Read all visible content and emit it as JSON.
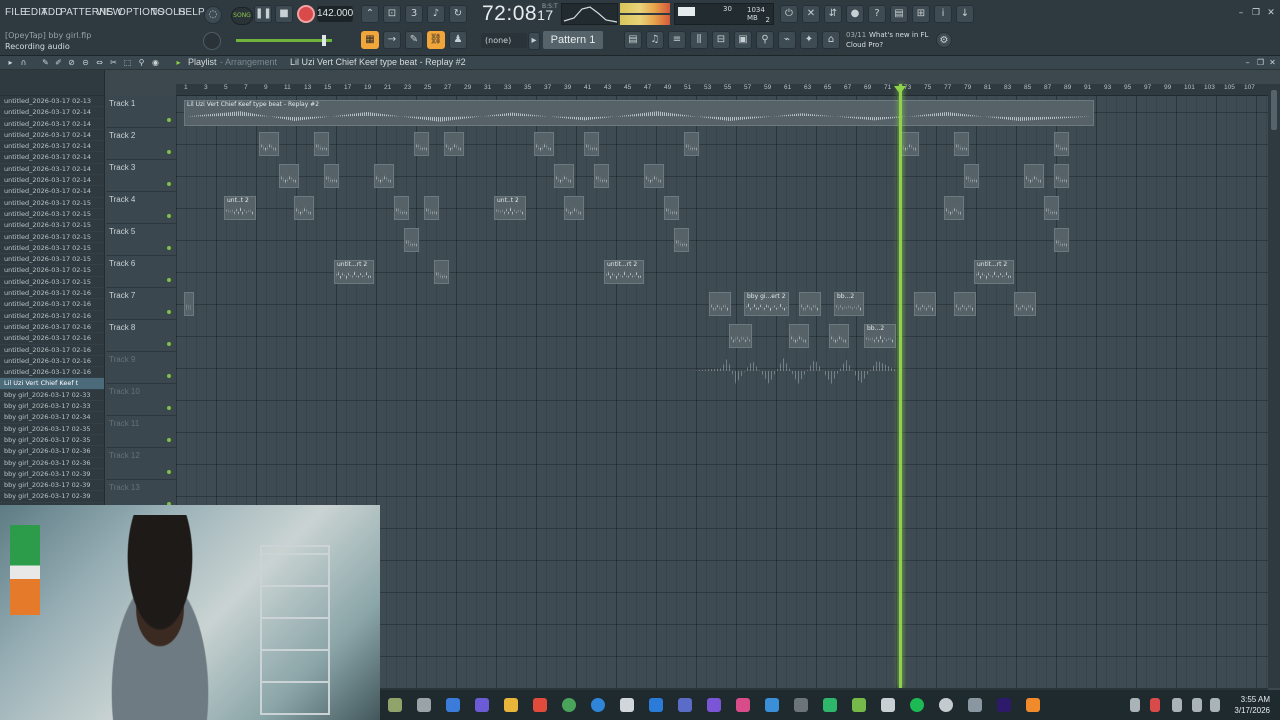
{
  "menu": [
    "FILE",
    "EDIT",
    "ADD",
    "PATTERNS",
    "VIEW",
    "OPTIONS",
    "TOOLS",
    "HELP"
  ],
  "project": {
    "label": "[OpeyTap] bby girl.flp",
    "status": "Recording audio"
  },
  "transport": {
    "mode": "SONG",
    "tempo": "142.000",
    "time": "72:08",
    "time_ticks": "17",
    "time_sub": "B:S:T"
  },
  "monitor": {
    "memory": "1034 MB",
    "voices": "30",
    "poly": "2"
  },
  "toolbar": {
    "pattern_none": "(none)",
    "pattern": "Pattern 1"
  },
  "news": {
    "date": "03/11",
    "text": "What's new in FL",
    "text2": "Cloud Pro?"
  },
  "playlist": {
    "title": "Playlist",
    "arrow": "-",
    "arrangement": "Arrangement",
    "breadcrumb": "Lil Uzi Vert  Chief Keef type beat - Replay #2"
  },
  "browser_items": [
    "untitled_2026-03-17 02-13",
    "untitled_2026-03-17 02-14",
    "untitled_2026-03-17 02-14",
    "untitled_2026-03-17 02-14",
    "untitled_2026-03-17 02-14",
    "untitled_2026-03-17 02-14",
    "untitled_2026-03-17 02-14",
    "untitled_2026-03-17 02-14",
    "untitled_2026-03-17 02-14",
    "untitled_2026-03-17 02-15",
    "untitled_2026-03-17 02-15",
    "untitled_2026-03-17 02-15",
    "untitled_2026-03-17 02-15",
    "untitled_2026-03-17 02-15",
    "untitled_2026-03-17 02-15",
    "untitled_2026-03-17 02-15",
    "untitled_2026-03-17 02-15",
    "untitled_2026-03-17 02-16",
    "untitled_2026-03-17 02-16",
    "untitled_2026-03-17 02-16",
    "untitled_2026-03-17 02-16",
    "untitled_2026-03-17 02-16",
    "untitled_2026-03-17 02-16",
    "untitled_2026-03-17 02-16",
    "untitled_2026-03-17 02-16",
    "Lil Uzi Vert  Chief Keef t",
    "bby girl_2026-03-17 02-33",
    "bby girl_2026-03-17 02-33",
    "bby girl_2026-03-17 02-34",
    "bby girl_2026-03-17 02-35",
    "bby girl_2026-03-17 02-35",
    "bby girl_2026-03-17 02-36",
    "bby girl_2026-03-17 02-36",
    "bby girl_2026-03-17 02-39",
    "bby girl_2026-03-17 02-39",
    "bby girl_2026-03-17 02-39"
  ],
  "selected_browser_index": 25,
  "tracks": [
    "Track 1",
    "Track 2",
    "Track 3",
    "Track 4",
    "Track 5",
    "Track 6",
    "Track 7",
    "Track 8",
    "Track 9",
    "Track 10",
    "Track 11",
    "Track 12",
    "Track 13"
  ],
  "ruler_ticks": [
    "1",
    "3",
    "5",
    "7",
    "9",
    "11",
    "13",
    "15",
    "17",
    "19",
    "21",
    "23",
    "25",
    "27",
    "29",
    "31",
    "33",
    "35",
    "37",
    "39",
    "41",
    "43",
    "45",
    "47",
    "49",
    "51",
    "53",
    "55",
    "57",
    "59",
    "61",
    "63",
    "65",
    "67",
    "69",
    "71",
    "73",
    "75",
    "77",
    "79",
    "81",
    "83",
    "85",
    "87",
    "89",
    "91",
    "93",
    "95",
    "97",
    "99",
    "101",
    "103",
    "105",
    "107"
  ],
  "clips": [
    {
      "track": 0,
      "start": 1,
      "len": 91,
      "label": "Lil Uzi Vert  Chief Keef type beat - Replay #2"
    },
    {
      "track": 1,
      "start": 8.5,
      "len": 2,
      "label": ""
    },
    {
      "track": 1,
      "start": 14,
      "len": 1.5,
      "label": ""
    },
    {
      "track": 1,
      "start": 24,
      "len": 1.5,
      "label": ""
    },
    {
      "track": 1,
      "start": 27,
      "len": 2,
      "label": ""
    },
    {
      "track": 1,
      "start": 36,
      "len": 2,
      "label": ""
    },
    {
      "track": 1,
      "start": 41,
      "len": 1.5,
      "label": ""
    },
    {
      "track": 1,
      "start": 51,
      "len": 1.5,
      "label": ""
    },
    {
      "track": 1,
      "start": 72.5,
      "len": 2,
      "label": ""
    },
    {
      "track": 1,
      "start": 78,
      "len": 1.5,
      "label": ""
    },
    {
      "track": 1,
      "start": 88,
      "len": 1.5,
      "label": ""
    },
    {
      "track": 2,
      "start": 10.5,
      "len": 2,
      "label": ""
    },
    {
      "track": 2,
      "start": 15,
      "len": 1.5,
      "label": ""
    },
    {
      "track": 2,
      "start": 20,
      "len": 2,
      "label": ""
    },
    {
      "track": 2,
      "start": 38,
      "len": 2,
      "label": ""
    },
    {
      "track": 2,
      "start": 42,
      "len": 1.5,
      "label": ""
    },
    {
      "track": 2,
      "start": 47,
      "len": 2,
      "label": ""
    },
    {
      "track": 2,
      "start": 79,
      "len": 1.5,
      "label": ""
    },
    {
      "track": 2,
      "start": 85,
      "len": 2,
      "label": ""
    },
    {
      "track": 2,
      "start": 88,
      "len": 1.5,
      "label": ""
    },
    {
      "track": 3,
      "start": 5,
      "len": 3.2,
      "label": "unt..t 2"
    },
    {
      "track": 3,
      "start": 12,
      "len": 2,
      "label": ""
    },
    {
      "track": 3,
      "start": 22,
      "len": 1.5,
      "label": ""
    },
    {
      "track": 3,
      "start": 25,
      "len": 1.5,
      "label": ""
    },
    {
      "track": 3,
      "start": 32,
      "len": 3.2,
      "label": "unt..t 2"
    },
    {
      "track": 3,
      "start": 39,
      "len": 2,
      "label": ""
    },
    {
      "track": 3,
      "start": 49,
      "len": 1.5,
      "label": ""
    },
    {
      "track": 3,
      "start": 77,
      "len": 2,
      "label": ""
    },
    {
      "track": 3,
      "start": 87,
      "len": 1.5,
      "label": ""
    },
    {
      "track": 4,
      "start": 23,
      "len": 1.5,
      "label": ""
    },
    {
      "track": 4,
      "start": 50,
      "len": 1.5,
      "label": ""
    },
    {
      "track": 4,
      "start": 88,
      "len": 1.5,
      "label": ""
    },
    {
      "track": 5,
      "start": 16,
      "len": 4,
      "label": "untit...rt 2"
    },
    {
      "track": 5,
      "start": 26,
      "len": 1.5,
      "label": ""
    },
    {
      "track": 5,
      "start": 43,
      "len": 4,
      "label": "untit...rt 2"
    },
    {
      "track": 5,
      "start": 80,
      "len": 4,
      "label": "untit...rt 2"
    },
    {
      "track": 6,
      "start": 1,
      "len": 1,
      "label": ""
    },
    {
      "track": 6,
      "start": 53.5,
      "len": 2.2,
      "label": ""
    },
    {
      "track": 6,
      "start": 57,
      "len": 4.5,
      "label": "bby gi...ert 2"
    },
    {
      "track": 6,
      "start": 62.5,
      "len": 2.2,
      "label": ""
    },
    {
      "track": 6,
      "start": 66,
      "len": 3,
      "label": "bb...2"
    },
    {
      "track": 6,
      "start": 74,
      "len": 2.2,
      "label": ""
    },
    {
      "track": 6,
      "start": 78,
      "len": 2.2,
      "label": ""
    },
    {
      "track": 6,
      "start": 84,
      "len": 2.2,
      "label": ""
    },
    {
      "track": 7,
      "start": 55.5,
      "len": 2.3,
      "label": ""
    },
    {
      "track": 7,
      "start": 61.5,
      "len": 2,
      "label": ""
    },
    {
      "track": 7,
      "start": 65.5,
      "len": 2,
      "label": ""
    },
    {
      "track": 7,
      "start": 69,
      "len": 3.2,
      "label": "bb...2"
    }
  ],
  "playhead_bar": 72.5,
  "taskbar": {
    "time": "3:55 AM",
    "date": "3/17/2026"
  }
}
